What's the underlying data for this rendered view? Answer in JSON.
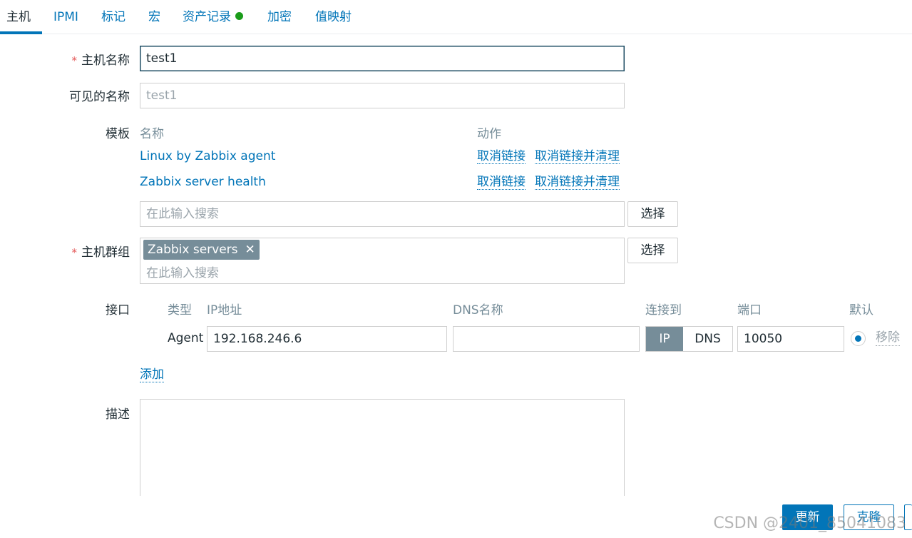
{
  "tabs": [
    {
      "label": "主机",
      "active": true
    },
    {
      "label": "IPMI"
    },
    {
      "label": "标记"
    },
    {
      "label": "宏"
    },
    {
      "label": "资产记录"
    },
    {
      "label": "加密"
    },
    {
      "label": "值映射"
    }
  ],
  "form": {
    "host_name_label": "主机名称",
    "host_name_value": "test1",
    "visible_name_label": "可见的名称",
    "visible_name_placeholder": "test1",
    "templates_label": "模板",
    "templates_header_name": "名称",
    "templates_header_action": "动作",
    "templates": [
      {
        "name": "Linux by Zabbix agent",
        "unlink": "取消链接",
        "unlink_clear": "取消链接并清理"
      },
      {
        "name": "Zabbix server health",
        "unlink": "取消链接",
        "unlink_clear": "取消链接并清理"
      }
    ],
    "search_placeholder": "在此输入搜索",
    "select_label": "选择",
    "host_groups_label": "主机群组",
    "host_group_tag": "Zabbix servers",
    "host_group_search_placeholder": "在此输入搜索",
    "interfaces_label": "接口",
    "interfaces_headers": {
      "type": "类型",
      "ip": "IP地址",
      "dns": "DNS名称",
      "connect": "连接到",
      "port": "端口",
      "default": "默认"
    },
    "interface": {
      "type": "Agent",
      "ip": "192.168.246.6",
      "dns": "",
      "connect_ip": "IP",
      "connect_dns": "DNS",
      "port": "10050",
      "remove": "移除"
    },
    "add_link": "添加",
    "description_label": "描述"
  },
  "footer": {
    "update": "更新",
    "clone": "克隆"
  },
  "watermark": "CSDN @2401_85041083",
  "colors": {
    "accent": "#0275b8",
    "tag": "#768d99",
    "status_dot": "#1a9c1a",
    "required": "#e45959"
  }
}
